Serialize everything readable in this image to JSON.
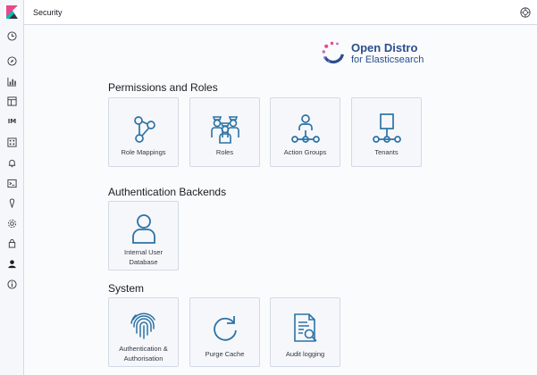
{
  "header": {
    "title": "Security"
  },
  "brand": {
    "line1": "Open Distro",
    "line2": "for Elasticsearch"
  },
  "nav": {
    "text_item": "IM"
  },
  "sections": [
    {
      "title": "Permissions and Roles",
      "tiles": [
        {
          "label": "Role Mappings",
          "icon": "role-mappings-icon"
        },
        {
          "label": "Roles",
          "icon": "roles-icon"
        },
        {
          "label": "Action Groups",
          "icon": "action-groups-icon"
        },
        {
          "label": "Tenants",
          "icon": "tenants-icon"
        }
      ]
    },
    {
      "title": "Authentication Backends",
      "tiles": [
        {
          "label_lines": [
            "Internal User",
            "Database"
          ],
          "icon": "user-icon"
        }
      ]
    },
    {
      "title": "System",
      "tiles": [
        {
          "label_lines": [
            "Authentication &",
            "Authorisation"
          ],
          "icon": "fingerprint-icon"
        },
        {
          "label": "Purge Cache",
          "icon": "refresh-icon"
        },
        {
          "label": "Audit logging",
          "icon": "audit-log-icon"
        }
      ]
    }
  ],
  "colors": {
    "icon": "#2c72a5",
    "brand_text": "#2a4e8d",
    "sidebar_bg": "#f5f7fa",
    "tile_bg": "#f5f7fa"
  }
}
